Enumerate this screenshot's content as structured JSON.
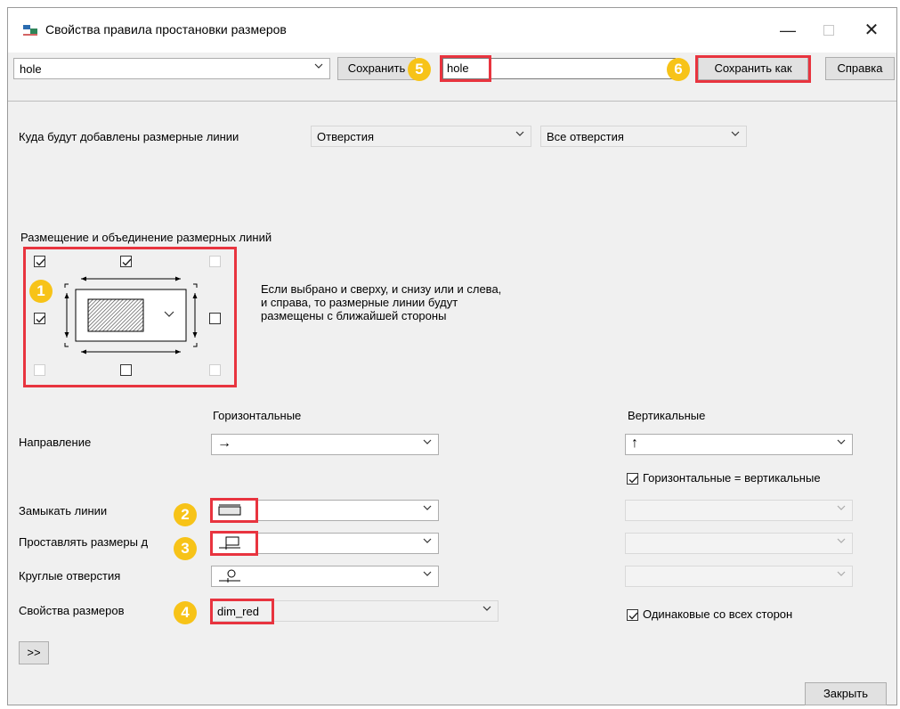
{
  "window": {
    "title": "Свойства правила простановки размеров"
  },
  "toolbar": {
    "rule_select_value": "hole",
    "save_label": "Сохранить",
    "name_input_value": "hole",
    "save_as_label": "Сохранить как",
    "help_label": "Справка"
  },
  "target": {
    "label": "Куда будут добавлены размерные линии",
    "type_value": "Отверстия",
    "scope_value": "Все отверстия"
  },
  "placement": {
    "title": "Размещение и объединение размерных линий",
    "hint_line1": "Если выбрано и сверху, и снизу или и слева,",
    "hint_line2": "и справа, то размерные линии будут",
    "hint_line3": "размещены с ближайшей стороны"
  },
  "columns": {
    "horizontal": "Горизонтальные",
    "vertical": "Вертикальные"
  },
  "rows": {
    "direction": "Направление",
    "close_lines": "Замыкать линии",
    "dim_to": "Проставлять размеры д",
    "round_holes": "Круглые отверстия",
    "dim_props": "Свойства размеров"
  },
  "values": {
    "h_direction": "→",
    "v_direction": "↑",
    "dim_props": "dim_red"
  },
  "checks": {
    "h_equals_v": "Горизонтальные = вертикальные",
    "same_all_sides": "Одинаковые со всех сторон"
  },
  "buttons": {
    "expand": ">>",
    "close": "Закрыть"
  },
  "badges": {
    "b1": "1",
    "b2": "2",
    "b3": "3",
    "b4": "4",
    "b5": "5",
    "b6": "6"
  },
  "colors": {
    "highlight": "#e8343f",
    "badge": "#f7c318"
  }
}
